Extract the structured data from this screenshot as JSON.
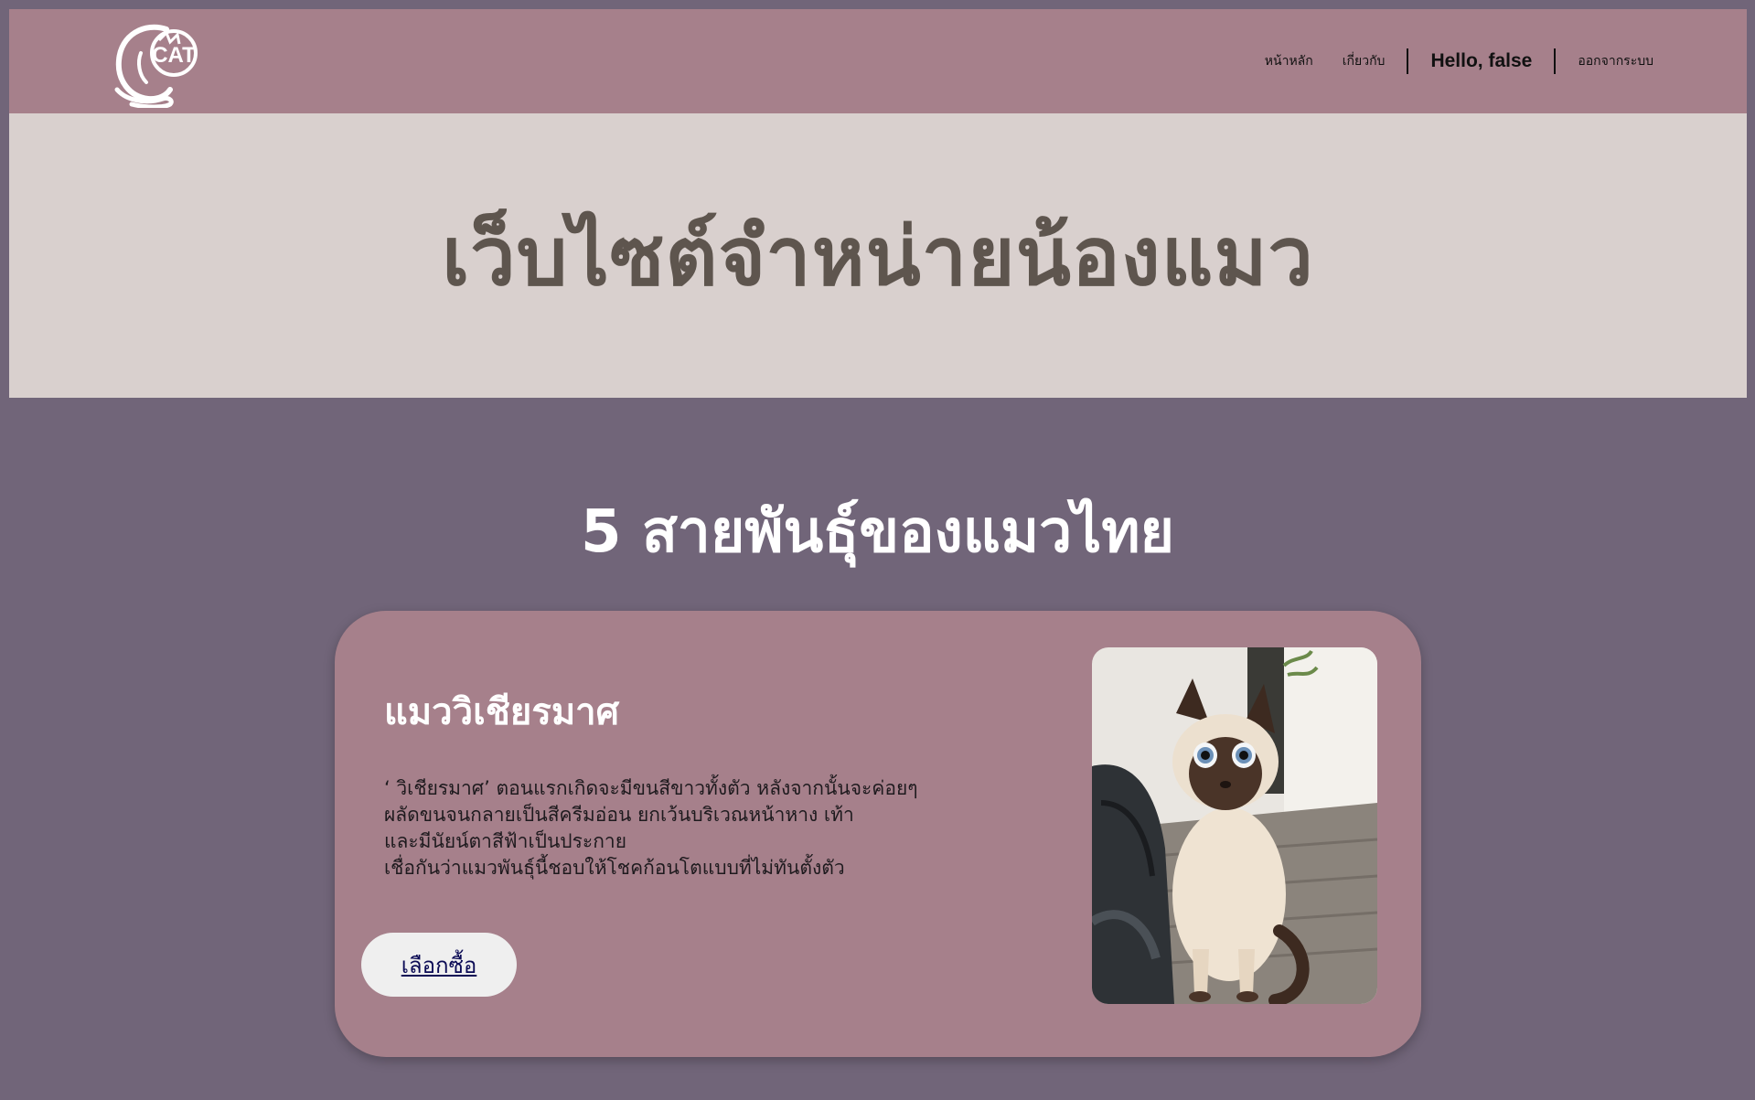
{
  "header": {
    "logo_text": "CAT",
    "nav": {
      "home_label": "หน้าหลัก",
      "about_label": "เกี่ยวกับ",
      "hello_text": "Hello, false",
      "logout_label": "ออกจากระบบ"
    }
  },
  "hero": {
    "title": "เว็บไซต์จำหน่ายน้องแมว"
  },
  "section": {
    "title": "5 สายพันธุ์ของแมวไทย"
  },
  "card": {
    "title": "แมววิเชียรมาศ",
    "description_lines": [
      "‘ วิเชียรมาศ’ ตอนแรกเกิดจะมีขนสีขาวทั้งตัว หลังจากนั้นจะค่อยๆ",
      "ผลัดขนจนกลายเป็นสีครีมอ่อน ยกเว้นบริเวณหน้าหาง เท้า",
      "และมีนัยน์ตาสีฟ้าเป็นประกาย",
      "เชื่อกันว่าแมวพันธุ์นี้ชอบให้โชคก้อนโตแบบที่ไม่ทันตั้งตัว"
    ],
    "buy_label": "เลือกซื้อ",
    "image_icon": "siamese-cat-photo"
  },
  "colors": {
    "page_bg": "#716579",
    "navbar_bg": "#a6808b",
    "hero_bg": "#d9d0ce",
    "hero_text": "#5e554e",
    "card_bg": "#a6808b",
    "button_bg": "#efefef"
  }
}
